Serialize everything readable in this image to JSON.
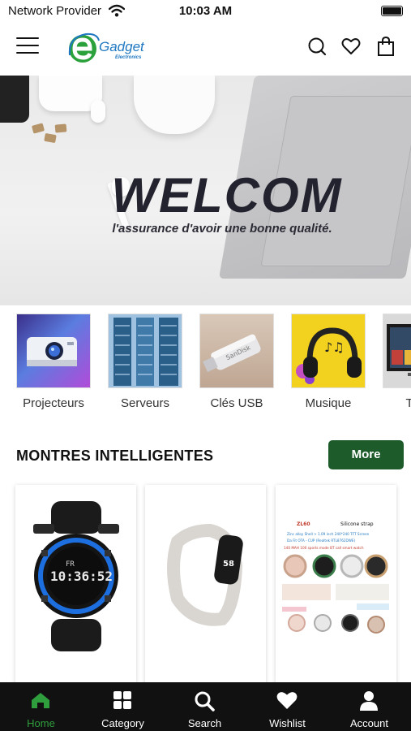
{
  "status_bar": {
    "carrier": "Network Provider",
    "time": "10:03 AM"
  },
  "header": {
    "logo_text": "Gadget",
    "logo_subtext": "Electronics",
    "icons": [
      "menu-icon",
      "search-icon",
      "heart-icon",
      "shopping-bag-icon"
    ]
  },
  "banner": {
    "headline": "WELCOM",
    "tagline": "l'assurance d'avoir une bonne qualité."
  },
  "categories": [
    {
      "label": "Projecteurs"
    },
    {
      "label": "Serveurs"
    },
    {
      "label": "Clés USB"
    },
    {
      "label": "Musique"
    },
    {
      "label": "Telec"
    }
  ],
  "section": {
    "title": "MONTRES INTELLIGENTES",
    "more_label": "More"
  },
  "products": [
    {
      "name": "digital-sport-watch"
    },
    {
      "name": "fitness-band"
    },
    {
      "name": "smartwatch-collage",
      "lines": [
        "ZL60",
        "Silicone strap",
        "Zinc alloy Shell > 1.09 inch 240*240 TFT Screen",
        "Da Fit OTA - CUP (Realtek RTL8762DWE)",
        "140 MAH 100 sports mode BT call smart watch"
      ]
    }
  ],
  "watch_display": {
    "top": "FR",
    "main": "10:36:52",
    "side": "58"
  },
  "tabbar": {
    "active": "Home",
    "tabs": [
      {
        "label": "Home",
        "icon": "home-icon"
      },
      {
        "label": "Category",
        "icon": "grid-icon"
      },
      {
        "label": "Search",
        "icon": "search-icon"
      },
      {
        "label": "Wishlist",
        "icon": "heart-icon"
      },
      {
        "label": "Account",
        "icon": "user-icon"
      }
    ]
  },
  "colors": {
    "primary": "#1d5c2a",
    "active_tab": "#2f9e3d",
    "tabbar_bg": "#111111",
    "logo_blue": "#1f78c1",
    "logo_green": "#2aa13a"
  }
}
